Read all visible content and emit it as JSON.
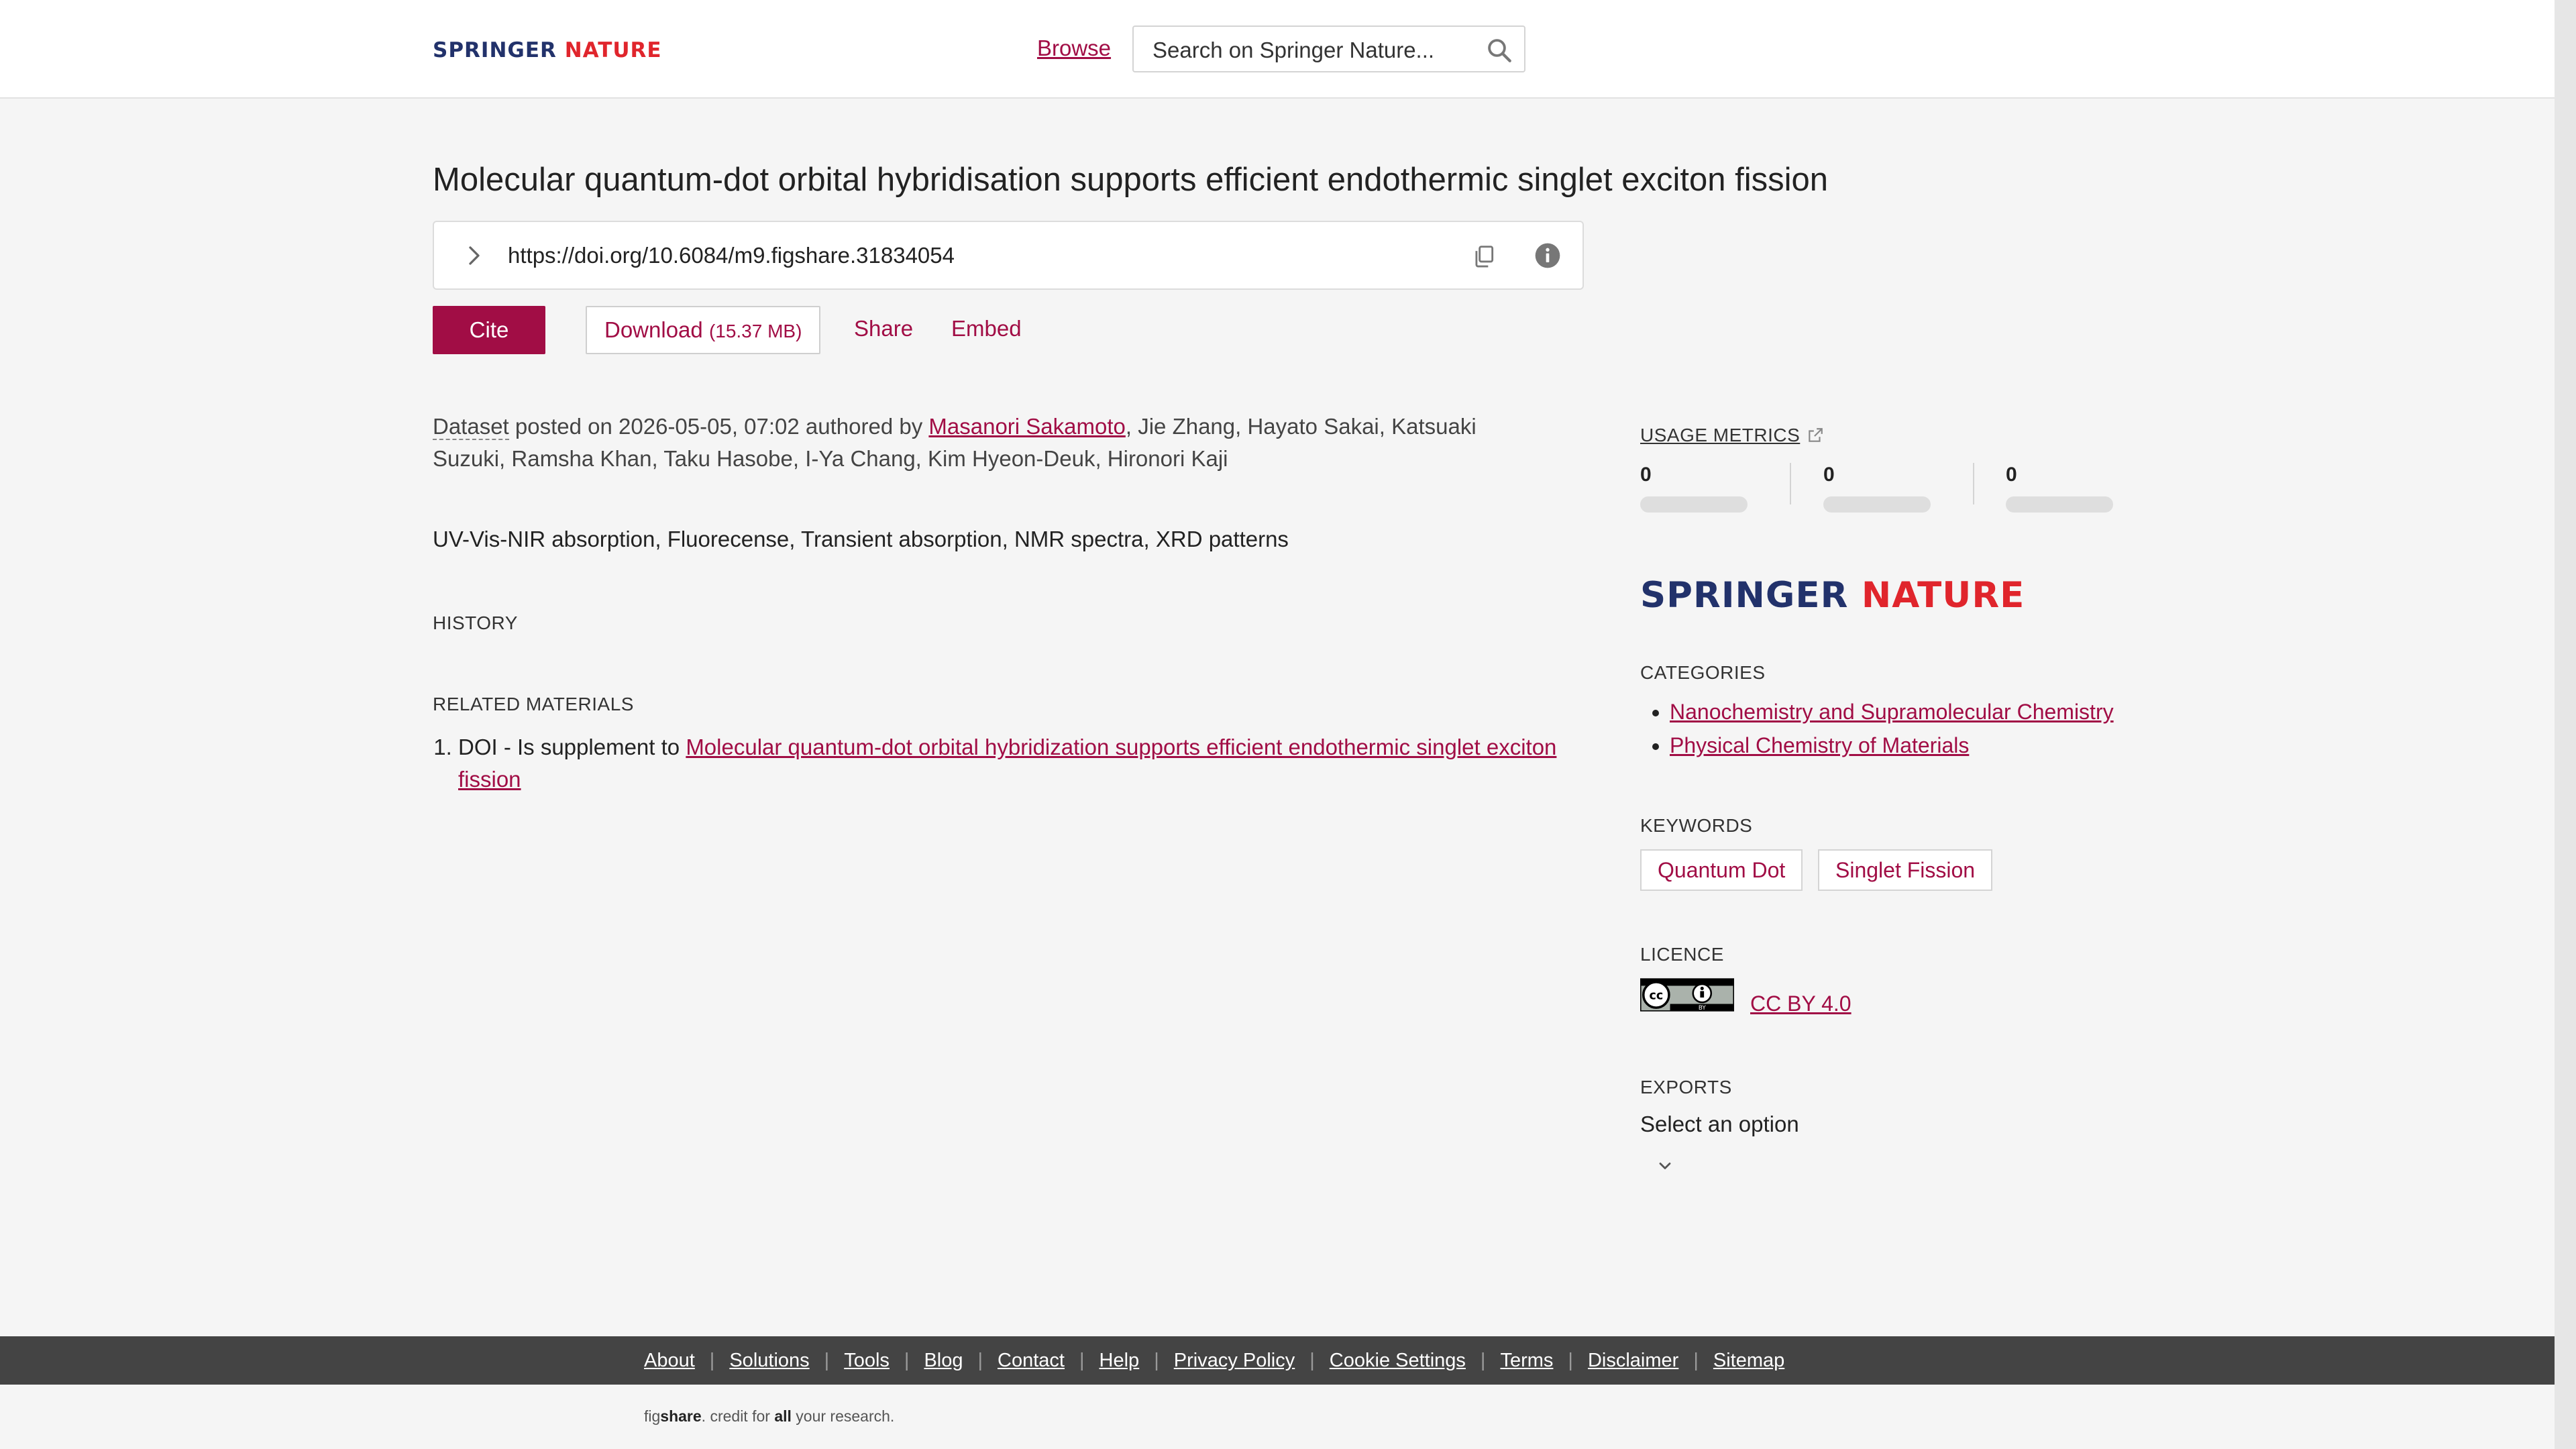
{
  "header": {
    "logo": {
      "part1": "SPRINGER ",
      "part2": "NATURE"
    },
    "browse_label": "Browse",
    "search_placeholder": "Search on Springer Nature..."
  },
  "item": {
    "title": "Molecular quantum-dot orbital hybridisation supports efficient endothermic singlet exciton fission",
    "doi_url": "https://doi.org/10.6084/m9.figshare.31834054",
    "actions": {
      "cite": "Cite",
      "download": "Download",
      "download_size": "(15.37 MB)",
      "share": "Share",
      "embed": "Embed"
    },
    "posted": {
      "type": "Dataset",
      "text": " posted on 2026-05-05, 07:02 authored by ",
      "first_author": "Masanori Sakamoto",
      "other_authors": ", Jie Zhang, Hayato Sakai, Katsuaki Suzuki, Ramsha Khan, Taku Hasobe, I-Ya Chang, Kim Hyeon-Deuk, Hironori Kaji"
    },
    "description": "UV-Vis-NIR absorption, Fluorecense, Transient absorption, NMR spectra, XRD patterns",
    "history_heading": "HISTORY",
    "related_heading": "RELATED MATERIALS",
    "related": [
      {
        "prefix": "DOI - Is supplement to ",
        "link": "Molecular quantum-dot orbital hybridization supports efficient endothermic singlet exciton fission"
      }
    ]
  },
  "sidebar": {
    "usage_label": "USAGE METRICS",
    "metrics": [
      "0",
      "0",
      "0"
    ],
    "logo": {
      "part1": "SPRINGER ",
      "part2": "NATURE"
    },
    "categories_heading": "CATEGORIES",
    "categories": [
      "Nanochemistry and Supramolecular Chemistry",
      "Physical Chemistry of Materials"
    ],
    "keywords_heading": "KEYWORDS",
    "keywords": [
      "Quantum Dot",
      "Singlet Fission"
    ],
    "licence_heading": "LICENCE",
    "licence_label": "CC BY 4.0",
    "cc_badge_text": {
      "cc": "cc",
      "by": "BY"
    },
    "exports_heading": "EXPORTS",
    "exports_select": "Select an option"
  },
  "footer": {
    "links": [
      "About",
      "Solutions",
      "Tools",
      "Blog",
      "Contact",
      "Help",
      "Privacy Policy",
      "Cookie Settings",
      "Terms",
      "Disclaimer",
      "Sitemap"
    ],
    "note_part1": "fig",
    "note_part2": "share",
    "note_part3": ". credit for ",
    "note_part4": "all",
    "note_part5": " your research."
  },
  "colors": {
    "accent": "#a10d45",
    "logo_blue": "#22326b",
    "logo_red": "#e0252c",
    "footer_bg": "#444444"
  }
}
